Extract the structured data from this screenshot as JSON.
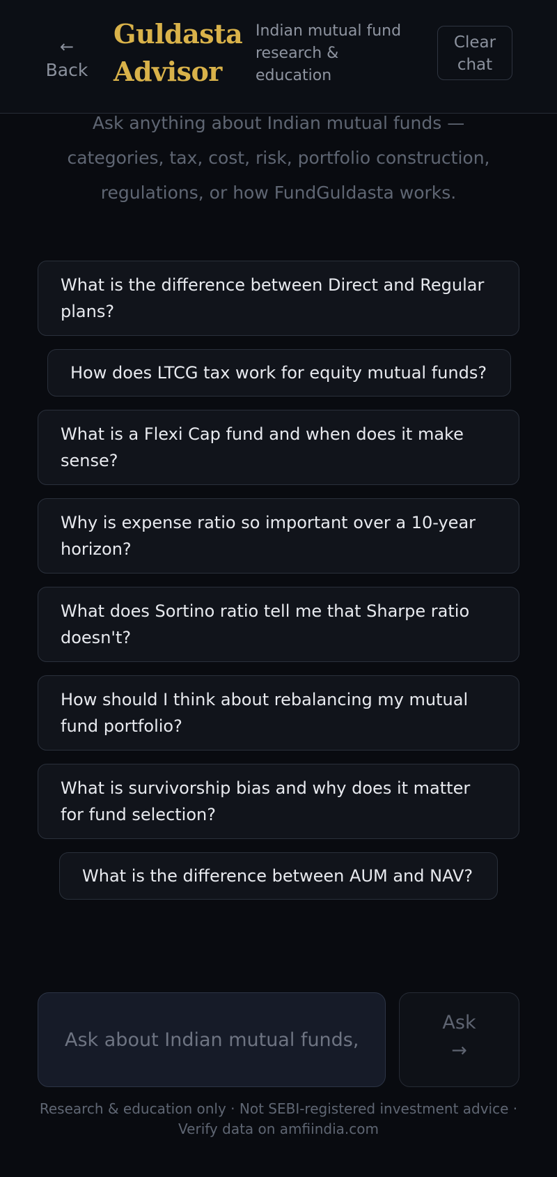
{
  "header": {
    "back_arrow": "←",
    "back_label": "Back",
    "brand_line1": "Guldasta",
    "brand_line2": "Advisor",
    "tagline": "Indian mutual fund research & education",
    "clear_label_line1": "Clear",
    "clear_label_line2": "chat"
  },
  "intro": "Ask anything about Indian mutual funds — categories, tax, cost, risk, portfolio construction, regulations, or how FundGuldasta works.",
  "suggestions": [
    "What is the difference between Direct and Regular plans?",
    "How does LTCG tax work for equity mutual funds?",
    "What is a Flexi Cap fund and when does it make sense?",
    "Why is expense ratio so important over a 10-year horizon?",
    "What does Sortino ratio tell me that Sharpe ratio doesn't?",
    "How should I think about rebalancing my mutual fund portfolio?",
    "What is survivorship bias and why does it matter for fund selection?",
    "What is the difference between AUM and NAV?"
  ],
  "composer": {
    "placeholder": "Ask about Indian mutual funds, tax, cost, risk…",
    "ask_label": "Ask",
    "ask_arrow": "→"
  },
  "disclaimer": {
    "line1": "Research & education only · Not SEBI-registered investment advice ·",
    "line2": "Verify data on amfiindia.com"
  },
  "colors": {
    "background": "#090b10",
    "brand_gold": "#d9b24a",
    "chip_background": "#11141b",
    "input_background": "#161b28"
  }
}
